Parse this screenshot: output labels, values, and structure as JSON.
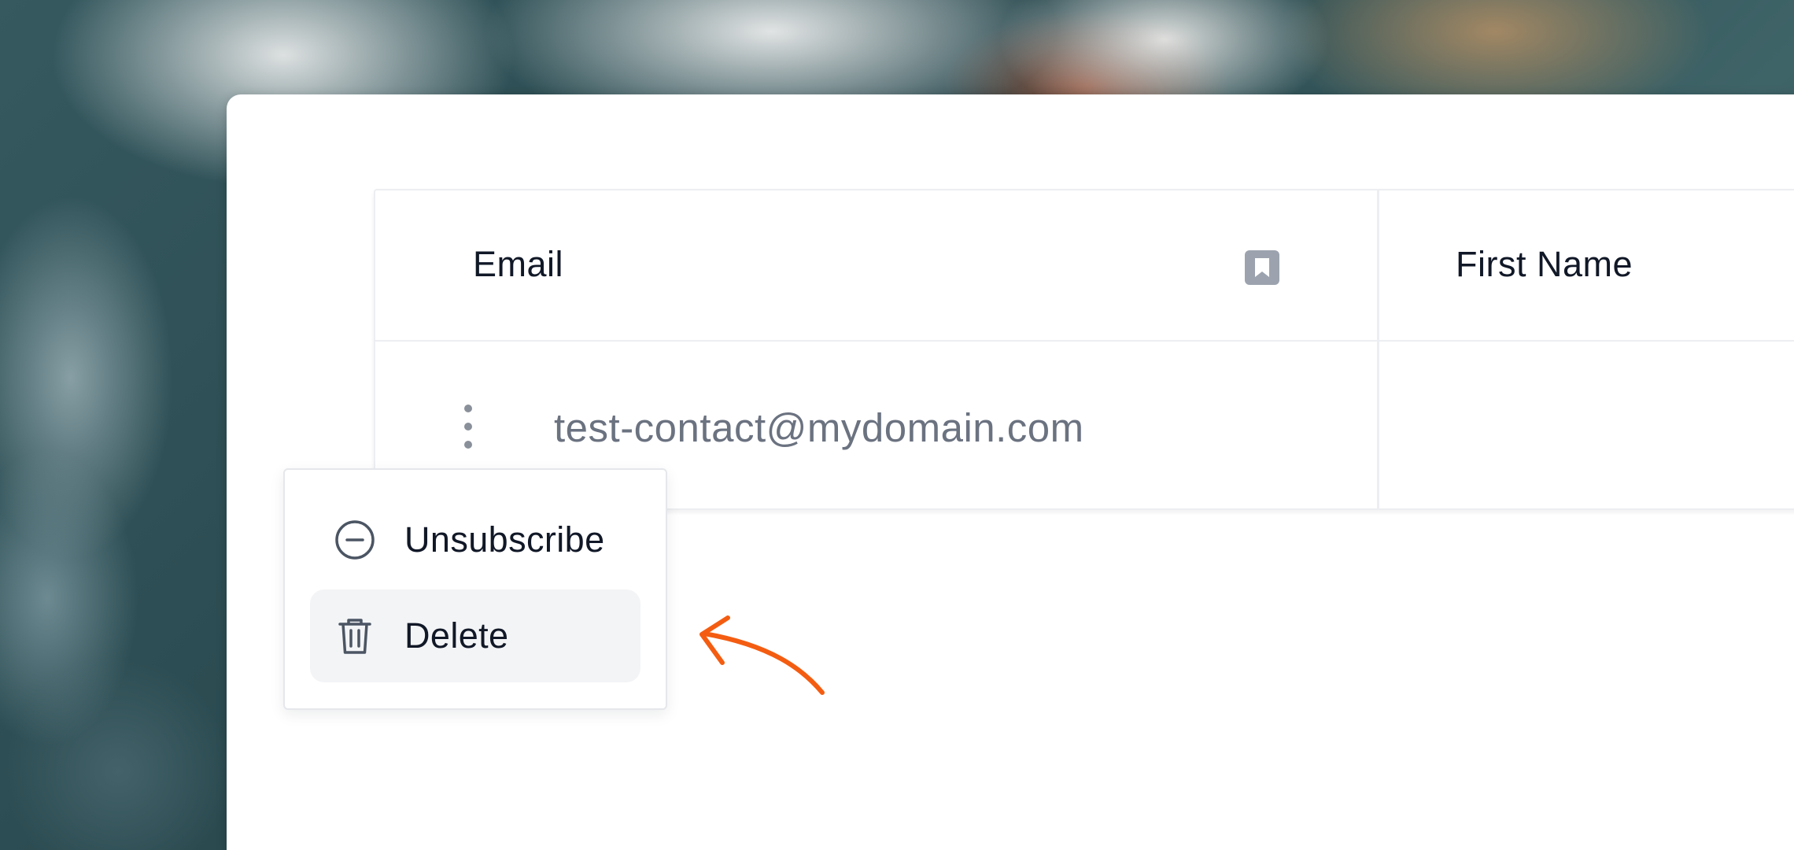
{
  "table": {
    "columns": [
      {
        "label": "Email",
        "icon": "bookmark-icon"
      },
      {
        "label": "First Name"
      }
    ],
    "rows": [
      {
        "email": "test-contact@mydomain.com",
        "first_name": ""
      }
    ]
  },
  "context_menu": {
    "items": [
      {
        "label": "Unsubscribe",
        "icon": "minus-circle-icon"
      },
      {
        "label": "Delete",
        "icon": "trash-icon",
        "highlighted": true
      }
    ]
  },
  "colors": {
    "annotation_arrow": "#f45d11",
    "highlight_bg": "#f3f4f6",
    "text_primary": "#111827",
    "text_secondary": "#6b7280"
  }
}
